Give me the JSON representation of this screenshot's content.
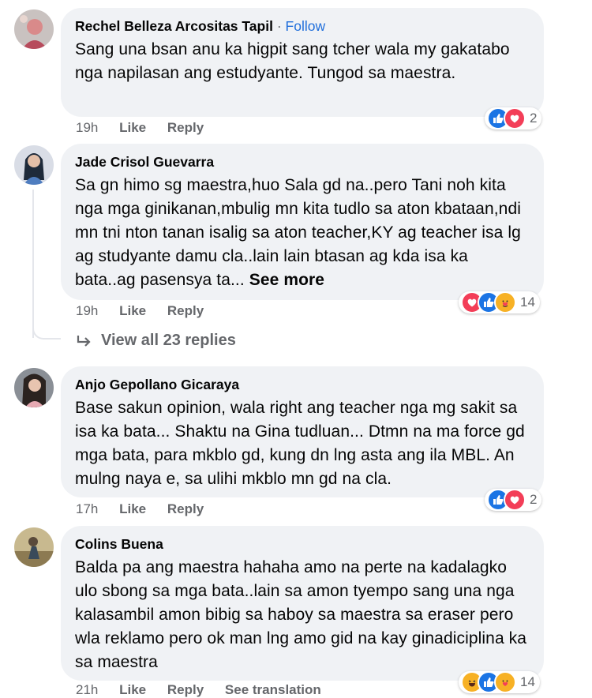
{
  "comments": [
    {
      "author": "Rechel Belleza Arcositas Tapil",
      "separator": "·",
      "follow_label": "Follow",
      "text": "Sang una bsan anu ka higpit sang tcher wala my gakatabo nga napilasan ang estudyante. Tungod sa maestra.",
      "time": "19h",
      "like_label": "Like",
      "reply_label": "Reply",
      "reactions": [
        "like-icon",
        "love-icon"
      ],
      "reaction_count": "2"
    },
    {
      "author": "Jade Crisol Guevarra",
      "text": "Sa gn himo sg maestra,huo Sala gd na..pero Tani noh kita nga mga ginikanan,mbulig mn kita tudlo sa aton kbataan,ndi mn tni nton tanan isalig sa aton teacher,KY ag teacher isa lg ag studyante damu cla..lain lain btasan ag kda isa ka bata..ag pasensya ta...",
      "see_more": "See more",
      "time": "19h",
      "like_label": "Like",
      "reply_label": "Reply",
      "reactions": [
        "love-icon",
        "like-icon",
        "care-icon"
      ],
      "reaction_count": "14",
      "view_replies": "View all 23 replies"
    },
    {
      "author": "Anjo Gepollano Gicaraya",
      "text": "Base sakun opinion, wala right ang teacher nga mg sakit sa isa ka bata... Shaktu na Gina tudluan... Dtmn na ma force gd mga bata, para mkblo gd, kung dn lng asta ang ila MBL. An mulng naya e, sa ulihi mkblo mn gd na cla.",
      "time": "17h",
      "like_label": "Like",
      "reply_label": "Reply",
      "reactions": [
        "like-icon",
        "love-icon"
      ],
      "reaction_count": "2"
    },
    {
      "author": "Colins Buena",
      "text": "Balda pa ang maestra hahaha amo na perte na kadalagko ulo sbong sa mga bata..lain sa amon tyempo sang una nga kalasambil amon bibig sa haboy sa maestra sa eraser pero wla reklamo pero ok man lng amo gid na kay ginadiciplina ka sa maestra",
      "time": "21h",
      "like_label": "Like",
      "reply_label": "Reply",
      "translation_label": "See translation",
      "reactions": [
        "haha-icon",
        "like-icon",
        "care-icon"
      ],
      "reaction_count": "14"
    }
  ],
  "colors": {
    "bubble": "#f0f2f5",
    "meta": "#65676b",
    "follow": "#216fdb"
  }
}
